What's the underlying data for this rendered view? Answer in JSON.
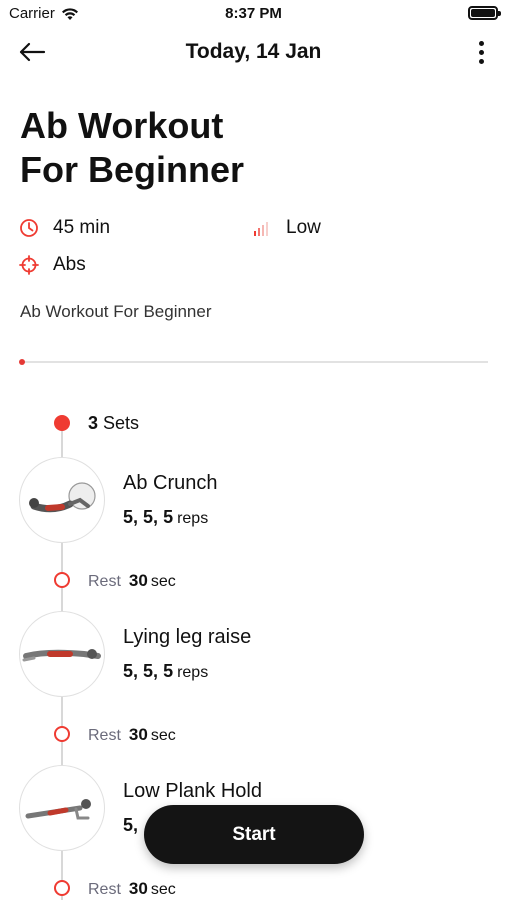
{
  "status_bar": {
    "carrier": "Carrier",
    "time": "8:37 PM"
  },
  "nav": {
    "title": "Today, 14 Jan"
  },
  "workout": {
    "title_line1": "Ab Workout",
    "title_line2": "For Beginner",
    "duration": "45 min",
    "level": "Low",
    "target": "Abs",
    "description": "Ab Workout For Beginner",
    "progress_fraction": 0
  },
  "timeline": {
    "sets_count": "3",
    "sets_label": "Sets",
    "exercises": [
      {
        "name": "Ab Crunch",
        "reps_1": "5",
        "reps_2": "5",
        "reps_3": "5",
        "unit": "reps",
        "rest_label": "Rest",
        "rest_value": "30",
        "rest_unit": "sec"
      },
      {
        "name": "Lying leg raise",
        "reps_1": "5",
        "reps_2": "5",
        "reps_3": "5",
        "unit": "reps",
        "rest_label": "Rest",
        "rest_value": "30",
        "rest_unit": "sec"
      },
      {
        "name": "Low Plank Hold",
        "reps_1": "5",
        "reps_2": "",
        "reps_3": "",
        "unit": "",
        "rest_label": "Rest",
        "rest_value": "30",
        "rest_unit": "sec"
      }
    ]
  },
  "actions": {
    "start_label": "Start"
  },
  "colors": {
    "accent": "#ef3b32",
    "button": "#141414",
    "muted_text": "#6b6b7b"
  },
  "icons": [
    "wifi-icon",
    "battery-icon",
    "back-arrow-icon",
    "more-icon",
    "clock-icon",
    "signal-bars-icon",
    "target-icon"
  ]
}
